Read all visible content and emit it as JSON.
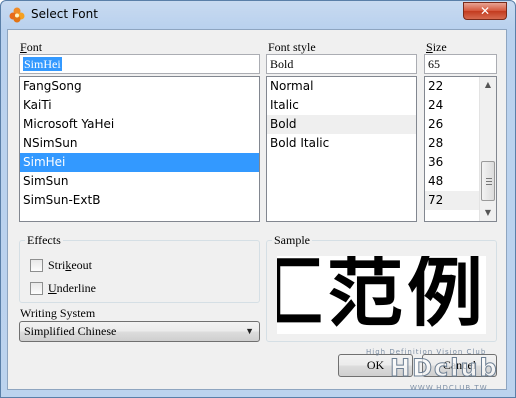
{
  "window": {
    "title": "Select Font",
    "close_glyph": "✕",
    "icon": "paint-palette-icon"
  },
  "font": {
    "label_accel": "F",
    "label_rest": "ont",
    "value": "SimHei",
    "items": [
      "FangSong",
      "KaiTi",
      "Microsoft YaHei",
      "NSimSun",
      "SimHei",
      "SimSun",
      "SimSun-ExtB"
    ],
    "selected": "SimHei"
  },
  "style": {
    "label": "Font style",
    "value": "Bold",
    "items": [
      "Normal",
      "Italic",
      "Bold",
      "Bold Italic"
    ],
    "selected": "Bold"
  },
  "size": {
    "label_accel": "S",
    "label_rest": "ize",
    "value": "65",
    "items": [
      "22",
      "24",
      "26",
      "28",
      "36",
      "48",
      "72"
    ],
    "highlighted": "72"
  },
  "effects": {
    "title": "Effects",
    "strikeout_accel": "k",
    "strikeout_pre": "Stri",
    "strikeout_post": "eout",
    "underline_accel": "U",
    "underline_rest": "nderline",
    "strikeout_checked": false,
    "underline_checked": false
  },
  "writing_system": {
    "label": "Writing System",
    "value": "Simplified Chinese"
  },
  "sample": {
    "title": "Sample",
    "text": "汇范例"
  },
  "buttons": {
    "ok": "OK",
    "cancel": "Cancel"
  },
  "watermark": {
    "tagline": "High Definition Vision Club",
    "logo": "HDclub",
    "url": "WWW.HDCLUB.TW"
  }
}
